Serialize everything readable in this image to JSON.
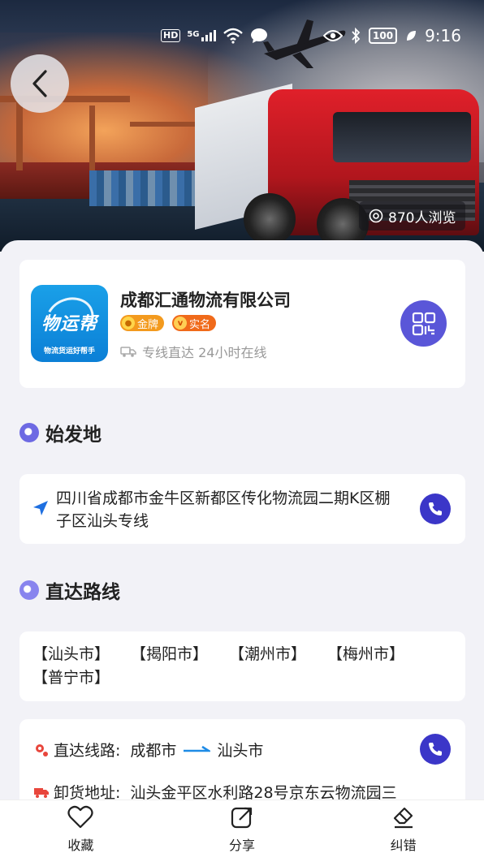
{
  "status_bar": {
    "hd": "HD",
    "signal": "5G",
    "battery": "100",
    "time": "9:16"
  },
  "hero": {
    "views": "870人浏览"
  },
  "company": {
    "logo_text": "物运帮",
    "logo_subtext": "物流货运好帮手",
    "name": "成都汇通物流有限公司",
    "badges": [
      {
        "label": "金牌",
        "icon": "medal-icon"
      },
      {
        "label": "实名",
        "icon": "verified-v-icon"
      }
    ],
    "tagline": "专线直达 24小时在线"
  },
  "origin": {
    "title": "始发地",
    "address": "四川省成都市金牛区新都区传化物流园二期K区棚子区汕头专线"
  },
  "routes": {
    "title": "直达路线",
    "cities": [
      "【汕头市】",
      "【揭阳市】",
      "【潮州市】",
      "【梅州市】",
      "【普宁市】"
    ]
  },
  "detail": {
    "line_label": "直达线路:",
    "line_from": "成都市",
    "line_to": "汕头市",
    "unload_label": "卸货地址:",
    "unload_value": "汕头金平区水利路28号京东云物流园三"
  },
  "bottom_bar": {
    "favorite": "收藏",
    "share": "分享",
    "report": "纠错"
  },
  "colors": {
    "accent": "#3b36c8",
    "accent_light": "#6d69e3",
    "badge_gold": "#f39a1e",
    "badge_real": "#f06a1a",
    "route_blue": "#1e8be6"
  }
}
